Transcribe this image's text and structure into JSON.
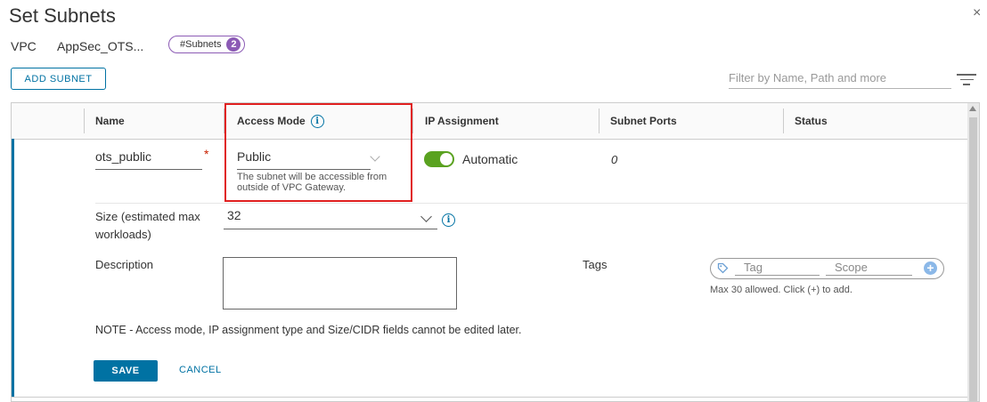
{
  "dialog": {
    "title": "Set Subnets",
    "close_icon": "×"
  },
  "header": {
    "vpc_label": "VPC",
    "vpc_name": "AppSec_OTS...",
    "subnets_label": "#Subnets",
    "subnets_count": "2"
  },
  "toolbar": {
    "add_subnet_label": "ADD SUBNET",
    "filter_placeholder": "Filter by Name, Path and more"
  },
  "table": {
    "columns": {
      "name": "Name",
      "access_mode": "Access Mode",
      "ip_assignment": "IP Assignment",
      "subnet_ports": "Subnet Ports",
      "status": "Status"
    }
  },
  "row": {
    "name_value": "ots_public",
    "required_marker": "*",
    "access_mode_value": "Public",
    "access_mode_help": "The subnet will be accessible from outside of VPC Gateway.",
    "ip_assignment_value": "Automatic",
    "ip_assignment_enabled": true,
    "subnet_ports_value": "0",
    "size_label": "Size (estimated max workloads)",
    "size_value": "32",
    "description_label": "Description",
    "description_value": "",
    "tags_label": "Tags",
    "tag_placeholder": "Tag",
    "scope_placeholder": "Scope",
    "tags_hint": "Max 30 allowed. Click (+) to add.",
    "note": "NOTE - Access mode, IP assignment type and Size/CIDR fields cannot be edited later.",
    "save_label": "SAVE",
    "cancel_label": "CANCEL"
  },
  "colors": {
    "accent": "#0072a3",
    "toggle_on": "#5aa220",
    "badge": "#8c5bb5",
    "highlight": "#e02020"
  }
}
